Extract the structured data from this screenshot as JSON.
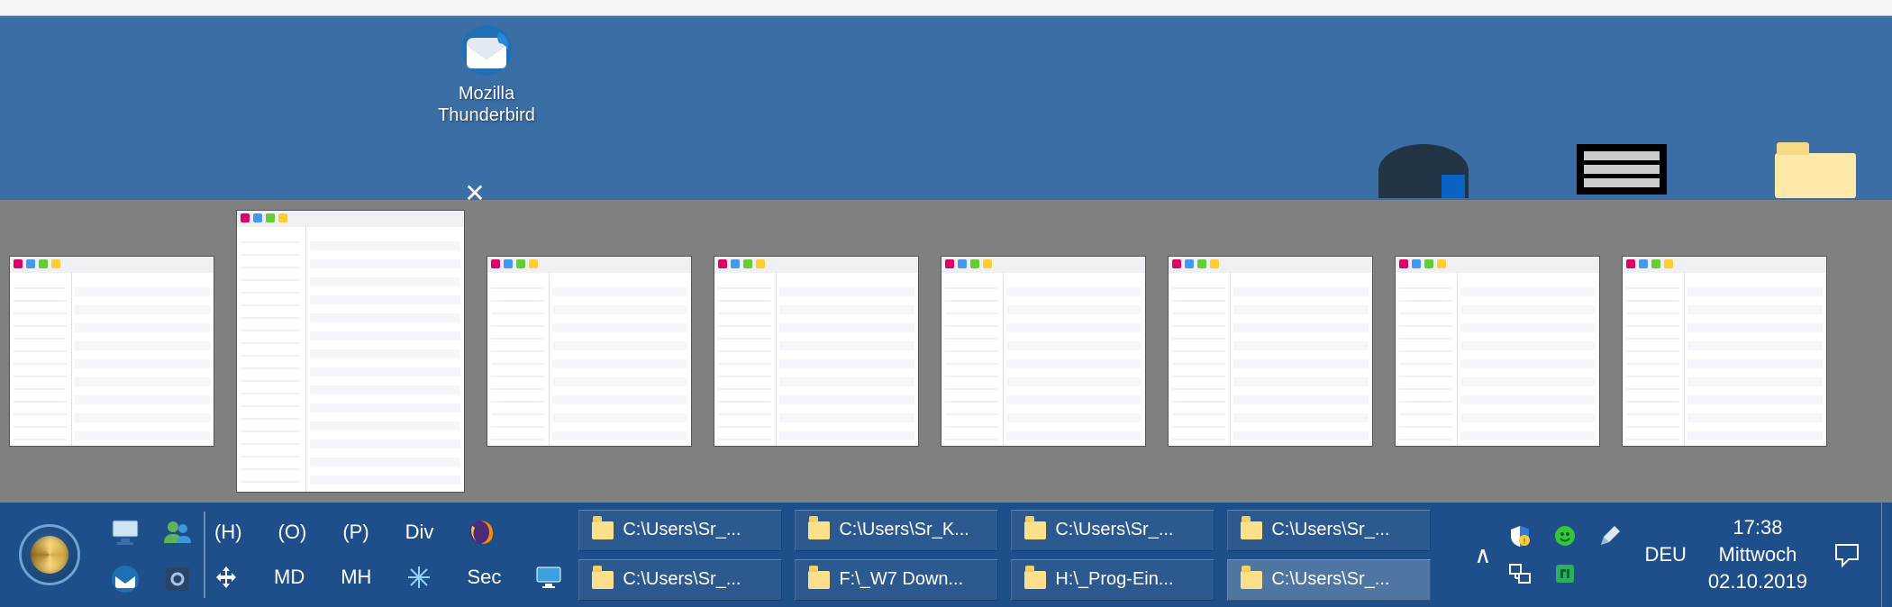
{
  "desktop_icons": [
    {
      "name": "thunderbird",
      "label": "Mozilla\nThunderbird"
    }
  ],
  "window_previews": {
    "count": 8,
    "active_index": 1,
    "close_tooltip": "Schließen"
  },
  "taskbar": {
    "quick_launch_top": [
      "mycomputer-icon",
      "users-icon"
    ],
    "quick_launch_bottom": [
      "thunderbird-icon",
      "settings-icon"
    ],
    "labeled_top": [
      {
        "type": "text",
        "label": "(H)"
      },
      {
        "type": "text",
        "label": "(O)"
      },
      {
        "type": "text",
        "label": "(P)"
      },
      {
        "type": "text",
        "label": "Div"
      },
      {
        "type": "icon",
        "name": "firefox-icon"
      }
    ],
    "labeled_bottom": [
      {
        "type": "icon",
        "name": "move-icon"
      },
      {
        "type": "text",
        "label": "MD"
      },
      {
        "type": "text",
        "label": "MH"
      },
      {
        "type": "icon",
        "name": "frost-icon"
      },
      {
        "type": "text",
        "label": "Sec"
      },
      {
        "type": "icon",
        "name": "monitor-icon"
      }
    ],
    "tasks_top": [
      {
        "label": "C:\\Users\\Sr_...",
        "active": false
      },
      {
        "label": "C:\\Users\\Sr_K...",
        "active": false
      },
      {
        "label": "C:\\Users\\Sr_...",
        "active": false
      },
      {
        "label": "C:\\Users\\Sr_...",
        "active": false
      }
    ],
    "tasks_bottom": [
      {
        "label": "C:\\Users\\Sr_...",
        "active": false
      },
      {
        "label": "F:\\_W7 Down...",
        "active": false
      },
      {
        "label": "H:\\_Prog-Ein...",
        "active": false
      },
      {
        "label": "C:\\Users\\Sr_...",
        "active": true
      }
    ]
  },
  "tray": {
    "icons_top": [
      "security-shield-icon",
      "status-green-icon",
      "pen-icon"
    ],
    "icons_bottom": [
      "network-icon",
      "app-icon"
    ],
    "language": "DEU",
    "time": "17:38",
    "weekday": "Mittwoch",
    "date": "02.10.2019"
  }
}
